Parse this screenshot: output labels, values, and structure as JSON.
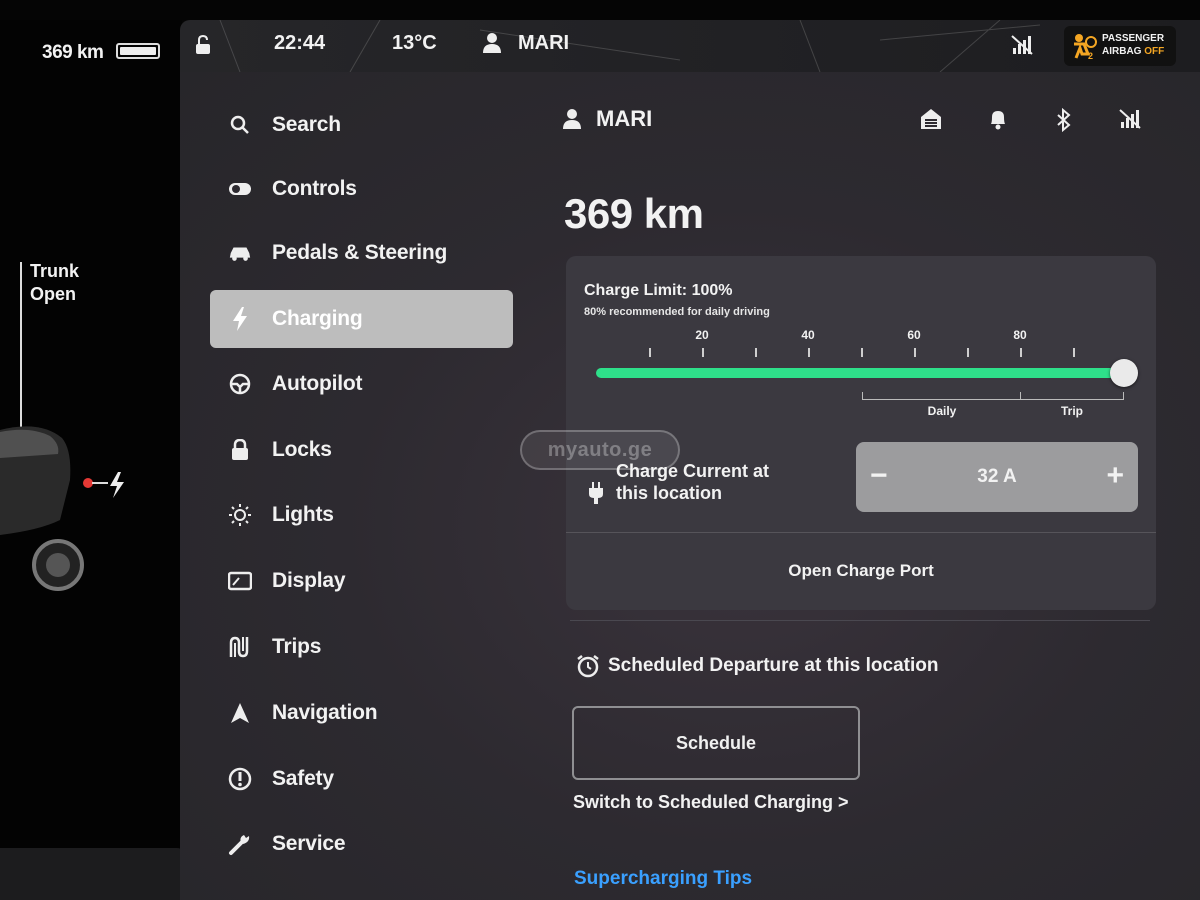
{
  "car_panel": {
    "range": "369 km",
    "trunk_line1": "Trunk",
    "trunk_line2": "Open",
    "icons": [
      "battery-icon",
      "charging-bolt-icon"
    ]
  },
  "status_bar": {
    "time": "22:44",
    "temperature": "13°C",
    "user": "MARI",
    "airbag_line1": "PASSENGER",
    "airbag_line2": "AIRBAG",
    "airbag_status": "OFF",
    "icons": [
      "lock-open-icon",
      "user-icon",
      "no-signal-icon",
      "airbag-icon"
    ],
    "colors": {
      "airbag_off": "#f4a623"
    }
  },
  "menu": {
    "items": [
      {
        "label": "Search",
        "icon": "search-icon"
      },
      {
        "label": "Controls",
        "icon": "toggle-icon"
      },
      {
        "label": "Pedals & Steering",
        "icon": "car-icon"
      },
      {
        "label": "Charging",
        "icon": "bolt-icon",
        "active": true
      },
      {
        "label": "Autopilot",
        "icon": "steering-wheel-icon"
      },
      {
        "label": "Locks",
        "icon": "lock-icon"
      },
      {
        "label": "Lights",
        "icon": "light-icon"
      },
      {
        "label": "Display",
        "icon": "display-icon"
      },
      {
        "label": "Trips",
        "icon": "trips-icon"
      },
      {
        "label": "Navigation",
        "icon": "navigation-icon"
      },
      {
        "label": "Safety",
        "icon": "safety-icon"
      },
      {
        "label": "Service",
        "icon": "wrench-icon"
      }
    ]
  },
  "header": {
    "profile_name": "MARI",
    "icons": [
      "user-icon",
      "garage-icon",
      "bell-icon",
      "bluetooth-icon",
      "no-signal-icon"
    ]
  },
  "charging": {
    "range": "369 km",
    "limit_title": "Charge Limit: 100%",
    "limit_subtitle": "80% recommended for daily driving",
    "limit_value_percent": 100,
    "scale_labels": [
      "20",
      "40",
      "60",
      "80"
    ],
    "daily_label": "Daily",
    "trip_label": "Trip",
    "current_label": "Charge Current at this location",
    "current_value": "32 A",
    "minus": "−",
    "plus": "+",
    "open_port": "Open Charge Port",
    "scheduled_departure": "Scheduled Departure at this location",
    "schedule_button": "Schedule",
    "switch_link": "Switch to Scheduled Charging >",
    "tips_link": "Supercharging Tips",
    "colors": {
      "slider": "#2ee08a",
      "link": "#3aa0ff"
    }
  },
  "watermark": "myauto.ge"
}
